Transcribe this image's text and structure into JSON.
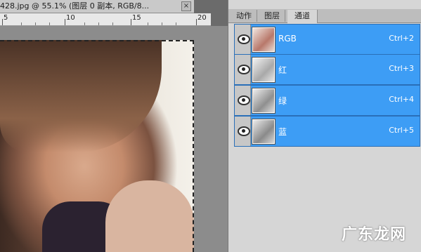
{
  "document": {
    "tab_title": "428.jpg @ 55.1% (图层 0 副本, RGB/8...",
    "close_label": "×"
  },
  "ruler": {
    "labels": [
      "5",
      "10",
      "15",
      "20"
    ]
  },
  "panel": {
    "tabs": [
      {
        "label": "动作",
        "active": false
      },
      {
        "label": "图层",
        "active": false
      },
      {
        "label": "通道",
        "active": true
      }
    ],
    "channels": [
      {
        "name": "RGB",
        "shortcut": "Ctrl+2",
        "thumb": "color"
      },
      {
        "name": "红",
        "shortcut": "Ctrl+3",
        "thumb": "gray"
      },
      {
        "name": "绿",
        "shortcut": "Ctrl+4",
        "thumb": "gray"
      },
      {
        "name": "蓝",
        "shortcut": "Ctrl+5",
        "thumb": "gray"
      }
    ]
  },
  "watermark": "广东龙网",
  "colors": {
    "selection": "#3d9df5",
    "panel_bg": "#d6d6d6"
  }
}
